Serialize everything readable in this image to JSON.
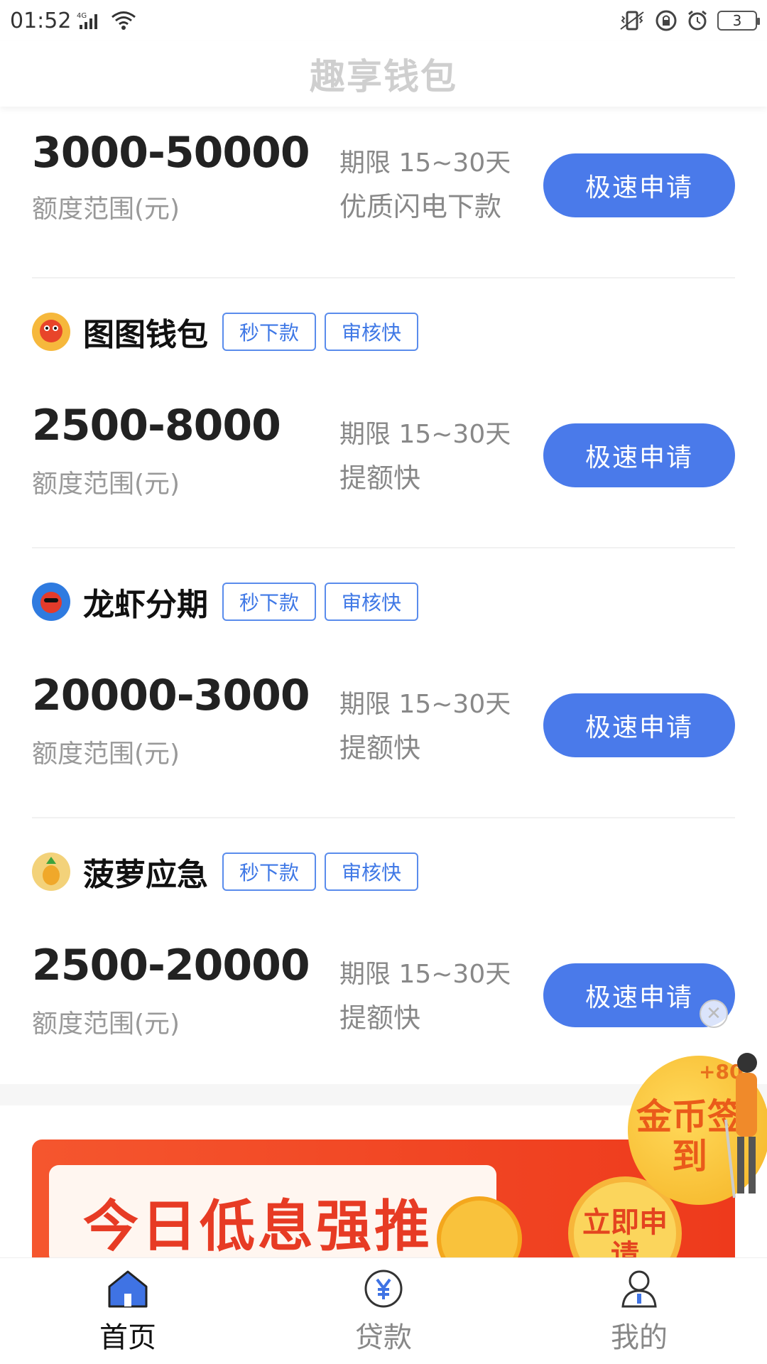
{
  "status_bar": {
    "time": "01:52",
    "network": "4G",
    "battery": "3"
  },
  "header": {
    "title": "趣享钱包"
  },
  "loans": [
    {
      "name": "",
      "tags": [],
      "amount": "3000-50000",
      "amount_label": "额度范围(元)",
      "term": "期限 15~30天",
      "feature": "优质闪电下款",
      "button": "极速申请"
    },
    {
      "name": "图图钱包",
      "tags": [
        "秒下款",
        "审核快"
      ],
      "amount": "2500-8000",
      "amount_label": "额度范围(元)",
      "term": "期限 15~30天",
      "feature": "提额快",
      "button": "极速申请"
    },
    {
      "name": "龙虾分期",
      "tags": [
        "秒下款",
        "审核快"
      ],
      "amount": "20000-3000",
      "amount_label": "额度范围(元)",
      "term": "期限 15~30天",
      "feature": "提额快",
      "button": "极速申请"
    },
    {
      "name": "菠萝应急",
      "tags": [
        "秒下款",
        "审核快"
      ],
      "amount": "2500-20000",
      "amount_label": "额度范围(元)",
      "term": "期限 15~30天",
      "feature": "提额快",
      "button": "极速申请"
    }
  ],
  "banner": {
    "text": "今日低息强推",
    "cta": "立即申请"
  },
  "float_signin": {
    "plus": "+80",
    "text": "金币签到"
  },
  "bottom_nav": [
    {
      "label": "首页",
      "icon": "home-icon",
      "active": true
    },
    {
      "label": "贷款",
      "icon": "yuan-icon",
      "active": false
    },
    {
      "label": "我的",
      "icon": "user-icon",
      "active": false
    }
  ],
  "colors": {
    "primary": "#4a7aea",
    "tag_border": "#5a8cec",
    "banner_red": "#ee3a1c"
  }
}
